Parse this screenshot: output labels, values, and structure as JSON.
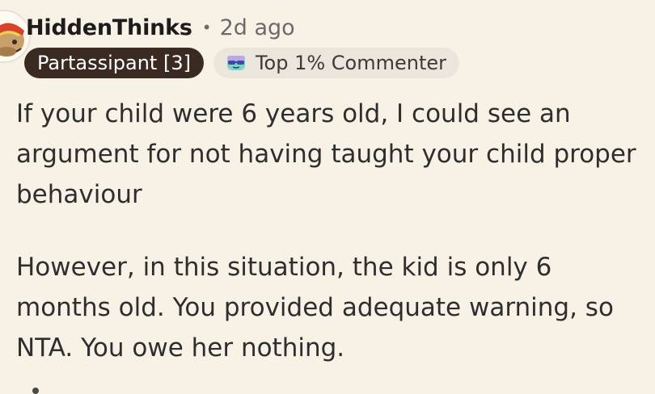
{
  "comment": {
    "username": "HiddenThinks",
    "separator": "•",
    "timestamp": "2d ago",
    "flair": "Partassipant [3]",
    "badge": {
      "icon": "sunglasses-face-icon",
      "label": "Top 1% Commenter"
    },
    "paragraphs": [
      "If your child were 6 years old, I could see an argument for not having taught your child proper behaviour",
      "However, in this situation, the kid is only 6 months old. You provided adequate warning, so NTA. You owe her nothing."
    ]
  },
  "colors": {
    "background": "#f8f2e6",
    "flair_bg": "#3a2a22",
    "badge_bg": "#ebe6dc",
    "text": "#2e2e2e",
    "muted": "#6a6a6a"
  }
}
